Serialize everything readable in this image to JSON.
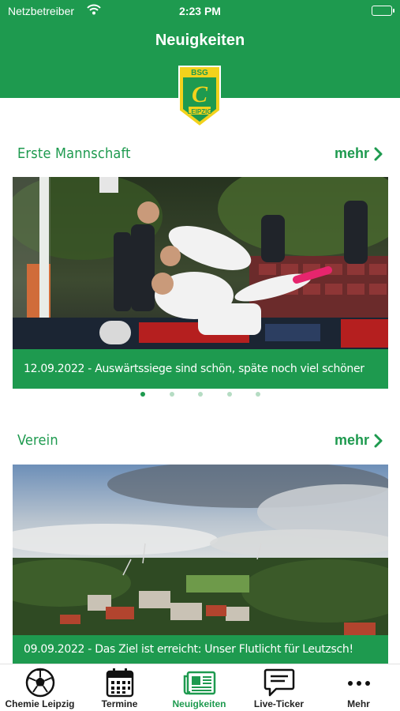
{
  "status_bar": {
    "carrier": "Netzbetreiber",
    "time": "2:23 PM"
  },
  "header": {
    "title": "Neuigkeiten",
    "logo_top_text": "BSG",
    "logo_bottom_text": "LEIPZIG",
    "logo_letter": "C"
  },
  "sections": [
    {
      "label": "Erste Mannschaft",
      "more_label": "mehr",
      "caption": "12.09.2022 - Auswärtssiege sind schön, späte noch viel schöner"
    },
    {
      "label": "Verein",
      "more_label": "mehr",
      "caption": "09.09.2022 - Das Ziel ist erreicht: Unser Flutlicht für Leutzsch!"
    }
  ],
  "carousel": {
    "page_count": 5,
    "active_index": 0
  },
  "tabbar": {
    "tabs": [
      {
        "label": "Chemie Leipzig",
        "icon": "football-icon"
      },
      {
        "label": "Termine",
        "icon": "calendar-icon"
      },
      {
        "label": "Neuigkeiten",
        "icon": "newspaper-icon"
      },
      {
        "label": "Live-Ticker",
        "icon": "chat-bubble-icon"
      },
      {
        "label": "Mehr",
        "icon": "more-dots-icon"
      }
    ],
    "active_index": 2
  },
  "colors": {
    "brand_green": "#1e9a4f",
    "logo_yellow": "#f2d21c"
  }
}
